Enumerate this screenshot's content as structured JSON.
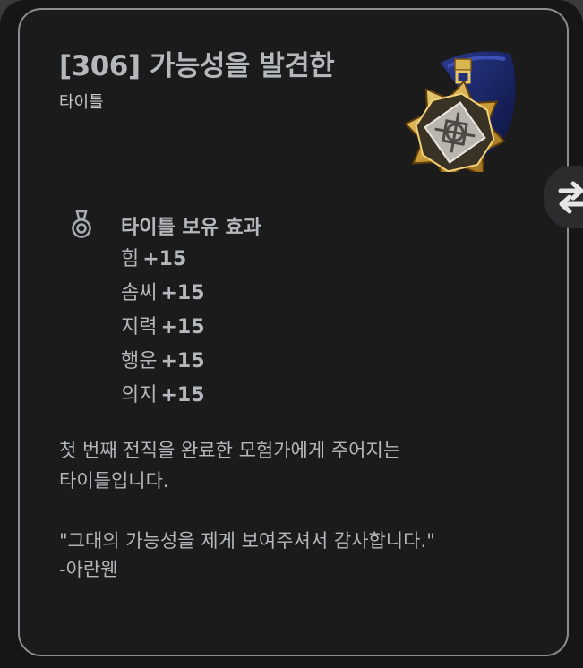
{
  "item": {
    "title": "[306] 가능성을 발견한",
    "category": "타이틀"
  },
  "effect": {
    "heading": "타이틀 보유 효과",
    "stats": [
      {
        "label": "힘",
        "value": "+15"
      },
      {
        "label": "솜씨",
        "value": "+15"
      },
      {
        "label": "지력",
        "value": "+15"
      },
      {
        "label": "행운",
        "value": "+15"
      },
      {
        "label": "의지",
        "value": "+15"
      }
    ]
  },
  "description": {
    "line1": "첫 번째 전직을 완료한 모험가에게 주어지는",
    "line2": "타이틀입니다."
  },
  "quote": {
    "text": "\"그대의 가능성을 제게 보여주셔서 감사합니다.\"",
    "author": "-아란웬"
  },
  "icons": {
    "emblem": "title-medal-icon",
    "effect": "medal-icon",
    "swap": "swap-arrows-icon"
  }
}
